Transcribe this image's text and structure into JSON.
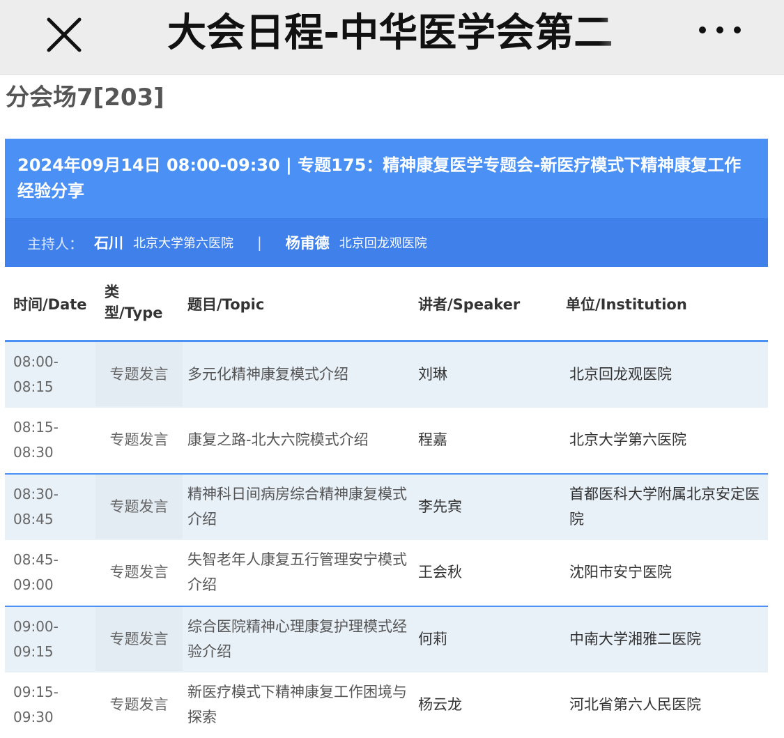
{
  "nav": {
    "title": "大会日程-中华医学会第二"
  },
  "venue": "分会场7[203]",
  "session": {
    "title": "2024年09月14日 08:00-09:30 | 专题175：精神康复医学专题会-新医疗模式下精神康复工作经验分享",
    "host_label": "主持人：",
    "hosts": [
      {
        "name": "石川",
        "institution": "北京大学第六医院"
      },
      {
        "name": "杨甫德",
        "institution": "北京回龙观医院"
      }
    ],
    "separator": "|"
  },
  "table": {
    "headers": {
      "time": "时间/Date",
      "type": "类型/Type",
      "topic": "题目/Topic",
      "speaker": "讲者/Speaker",
      "institution": "单位/Institution"
    },
    "rows": [
      {
        "time": "08:00-08:15",
        "type": "专题发言",
        "topic": "多元化精神康复模式介绍",
        "speaker": "刘琳",
        "institution": "北京回龙观医院"
      },
      {
        "time": "08:15-08:30",
        "type": "专题发言",
        "topic": "康复之路-北大六院模式介绍",
        "speaker": "程嘉",
        "institution": "北京大学第六医院"
      },
      {
        "time": "08:30-08:45",
        "type": "专题发言",
        "topic": "精神科日间病房综合精神康复模式介绍",
        "speaker": "李先宾",
        "institution": "首都医科大学附属北京安定医院"
      },
      {
        "time": "08:45-09:00",
        "type": "专题发言",
        "topic": "失智老年人康复五行管理安宁模式介绍",
        "speaker": "王会秋",
        "institution": "沈阳市安宁医院"
      },
      {
        "time": "09:00-09:15",
        "type": "专题发言",
        "topic": "综合医院精神心理康复护理模式经验介绍",
        "speaker": "何莉",
        "institution": "中南大学湘雅二医院"
      },
      {
        "time": "09:15-09:30",
        "type": "专题发言",
        "topic": "新医疗模式下精神康复工作困境与探索",
        "speaker": "杨云龙",
        "institution": "河北省第六人民医院"
      }
    ]
  },
  "colors": {
    "accent": "#4a90f5",
    "host_bar": "#3f80ea",
    "row_alt": "#e8f0f8"
  },
  "icons": {
    "close": "close-icon",
    "more": "more-dots-icon"
  }
}
